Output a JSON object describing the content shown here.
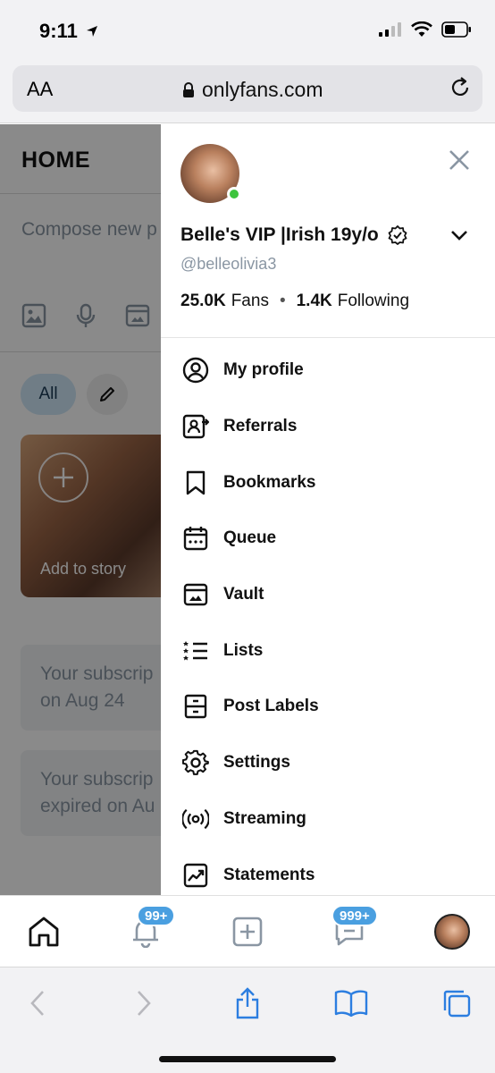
{
  "status_bar": {
    "time": "9:11"
  },
  "browser": {
    "text_size_label": "AA",
    "url": "onlyfans.com"
  },
  "home": {
    "title": "HOME",
    "compose_placeholder": "Compose new p",
    "filter_all": "All",
    "story_label": "Add to story",
    "subscription_cards": [
      {
        "line1": "Your subscrip",
        "line2": "on Aug 24"
      },
      {
        "line1": "Your subscrip",
        "line2": "expired on Au"
      }
    ]
  },
  "drawer": {
    "name": "Belle's VIP |Irish 19y/o",
    "handle": "@belleolivia3",
    "fans_count": "25.0K",
    "fans_label": "Fans",
    "following_count": "1.4K",
    "following_label": "Following",
    "menu": [
      {
        "label": "My profile",
        "icon": "user-circle-icon"
      },
      {
        "label": "Referrals",
        "icon": "referral-icon"
      },
      {
        "label": "Bookmarks",
        "icon": "bookmark-icon"
      },
      {
        "label": "Queue",
        "icon": "calendar-icon"
      },
      {
        "label": "Vault",
        "icon": "vault-icon"
      },
      {
        "label": "Lists",
        "icon": "list-icon"
      },
      {
        "label": "Post Labels",
        "icon": "post-labels-icon"
      },
      {
        "label": "Settings",
        "icon": "gear-icon"
      },
      {
        "label": "Streaming",
        "icon": "streaming-icon"
      },
      {
        "label": "Statements",
        "icon": "statements-icon"
      }
    ]
  },
  "bottom_nav": {
    "notifications_badge": "99+",
    "messages_badge": "999+"
  },
  "colors": {
    "accent": "#4a9fe0",
    "online": "#3ec43e",
    "muted_text": "#8a96a3"
  }
}
